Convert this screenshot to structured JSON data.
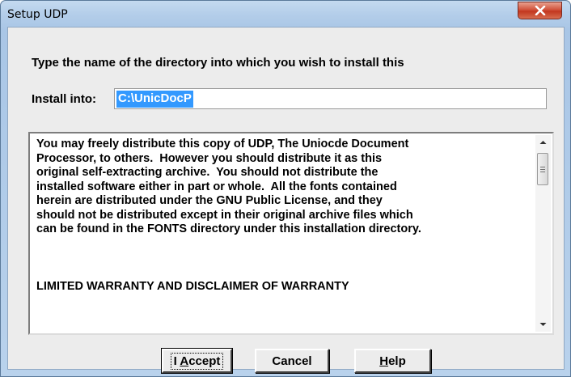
{
  "window": {
    "title": "Setup UDP"
  },
  "dialog": {
    "prompt": "Type the name of the directory into which you wish to install this",
    "install_label": "Install into:",
    "install_value": "C:\\UnicDocP",
    "license_text": "You may freely distribute this copy of UDP, The Uniocde Document\nProcessor, to others.  However you should distribute it as this\noriginal self-extracting archive.  You should not distribute the\ninstalled software either in part or whole.  All the fonts contained\nherein are distributed under the GNU Public License, and they\nshould not be distributed except in their original archive files which\ncan be found in the FONTS directory under this installation directory.",
    "license_warranty": "LIMITED WARRANTY AND DISCLAIMER OF WARRANTY"
  },
  "buttons": {
    "accept_prefix": "I ",
    "accept_hotkey": "A",
    "accept_rest": "ccept",
    "cancel": "Cancel",
    "help_hotkey": "H",
    "help_rest": "elp"
  },
  "icons": {
    "close": "close-icon",
    "scroll_up": "chevron-up-icon",
    "scroll_down": "chevron-down-icon"
  },
  "colors": {
    "selection": "#3399ff",
    "close_button": "#c2371f",
    "dialog_background": "#ececec"
  }
}
